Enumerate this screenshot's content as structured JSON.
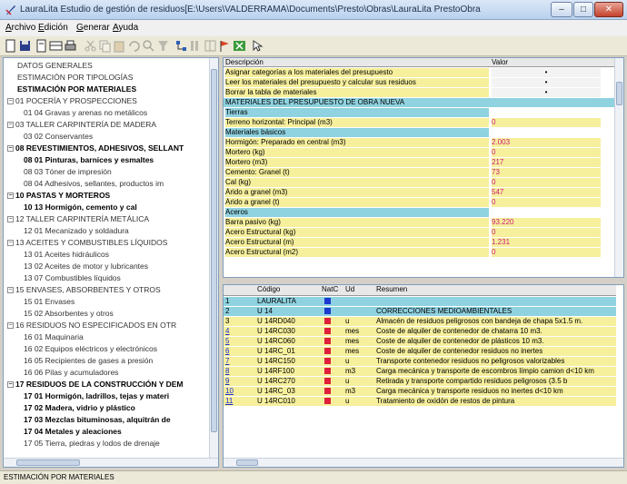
{
  "window": {
    "title": "LauraLita Estudio de gestión de residuos[E:\\Users\\VALDERRAMA\\Documents\\Presto\\Obras\\LauraLita PrestoObra"
  },
  "menu": {
    "items": [
      "Archivo",
      "Edición",
      "Generar",
      "Ayuda"
    ]
  },
  "tree": {
    "items": [
      {
        "label": "DATOS GENERALES",
        "bold": false,
        "toggle": "",
        "level": 0
      },
      {
        "label": "ESTIMACIÓN POR TIPOLOGÍAS",
        "bold": false,
        "toggle": "",
        "level": 0
      },
      {
        "label": "ESTIMACIÓN POR MATERIALES",
        "bold": true,
        "toggle": "",
        "level": 0
      },
      {
        "label": "01 POCERÍA Y PROSPECCIONES",
        "bold": false,
        "toggle": "−",
        "level": 0
      },
      {
        "label": "01 04 Gravas y arenas no metálicos",
        "bold": false,
        "toggle": "",
        "level": 1
      },
      {
        "label": "03 TALLER CARPINTERÍA DE MADERA",
        "bold": false,
        "toggle": "−",
        "level": 0
      },
      {
        "label": "03 02 Conservantes",
        "bold": false,
        "toggle": "",
        "level": 1
      },
      {
        "label": "08 REVESTIMIENTOS, ADHESIVOS, SELLANT",
        "bold": true,
        "toggle": "−",
        "level": 0
      },
      {
        "label": "08 01 Pinturas, barnices y esmaltes",
        "bold": true,
        "toggle": "",
        "level": 1
      },
      {
        "label": "08 03 Tóner de impresión",
        "bold": false,
        "toggle": "",
        "level": 1
      },
      {
        "label": "08 04 Adhesivos, sellantes, productos im",
        "bold": false,
        "toggle": "",
        "level": 1
      },
      {
        "label": "10 PASTAS Y MORTEROS",
        "bold": true,
        "toggle": "−",
        "level": 0
      },
      {
        "label": "10 13 Hormigón, cemento y cal",
        "bold": true,
        "toggle": "",
        "level": 1
      },
      {
        "label": "12 TALLER CARPINTERÍA METÁLICA",
        "bold": false,
        "toggle": "−",
        "level": 0
      },
      {
        "label": "12 01 Mecanizado y soldadura",
        "bold": false,
        "toggle": "",
        "level": 1
      },
      {
        "label": "13 ACEITES Y COMBUSTIBLES LÍQUIDOS",
        "bold": false,
        "toggle": "−",
        "level": 0
      },
      {
        "label": "13 01 Aceites hidráulicos",
        "bold": false,
        "toggle": "",
        "level": 1
      },
      {
        "label": "13 02 Aceites de motor y lubricantes",
        "bold": false,
        "toggle": "",
        "level": 1
      },
      {
        "label": "13 07 Combustibles líquidos",
        "bold": false,
        "toggle": "",
        "level": 1
      },
      {
        "label": "15 ENVASES, ABSORBENTES Y OTROS",
        "bold": false,
        "toggle": "−",
        "level": 0
      },
      {
        "label": "15 01 Envases",
        "bold": false,
        "toggle": "",
        "level": 1
      },
      {
        "label": "15 02 Absorbentes y otros",
        "bold": false,
        "toggle": "",
        "level": 1
      },
      {
        "label": "16 RESIDUOS NO ESPECIFICADOS EN OTR",
        "bold": false,
        "toggle": "−",
        "level": 0
      },
      {
        "label": "16 01 Maquinaria",
        "bold": false,
        "toggle": "",
        "level": 1
      },
      {
        "label": "16 02 Equipos eléctricos y electrónicos",
        "bold": false,
        "toggle": "",
        "level": 1
      },
      {
        "label": "16 05 Recipientes de gases a presión",
        "bold": false,
        "toggle": "",
        "level": 1
      },
      {
        "label": "16 06 Pilas y acumuladores",
        "bold": false,
        "toggle": "",
        "level": 1
      },
      {
        "label": "17 RESIDUOS DE LA CONSTRUCCIÓN Y DEM",
        "bold": true,
        "toggle": "−",
        "level": 0
      },
      {
        "label": "17 01 Hormigón, ladrillos, tejas y materi",
        "bold": true,
        "toggle": "",
        "level": 1
      },
      {
        "label": "17 02 Madera, vidrio y plástico",
        "bold": true,
        "toggle": "",
        "level": 1
      },
      {
        "label": "17 03 Mezclas bituminosas, alquitrán de",
        "bold": true,
        "toggle": "",
        "level": 1
      },
      {
        "label": "17 04 Metales y aleaciones",
        "bold": true,
        "toggle": "",
        "level": 1
      },
      {
        "label": "17 05 Tierra, piedras y lodos de drenaje",
        "bold": false,
        "toggle": "",
        "level": 1
      }
    ]
  },
  "upper": {
    "header": {
      "desc": "Descripción",
      "valor": "Valor"
    },
    "rows": [
      {
        "kind": "act",
        "desc": "Asignar categorías a los materiales del presupuesto",
        "val": "•"
      },
      {
        "kind": "act",
        "desc": "Leer los materiales del presupuesto y calcular sus residuos",
        "val": "•"
      },
      {
        "kind": "act",
        "desc": "Borrar la tabla de materiales",
        "val": "•"
      },
      {
        "kind": "sec",
        "desc": "MATERIALES DEL PRESUPUESTO DE OBRA NUEVA",
        "val": ""
      },
      {
        "kind": "sub",
        "desc": "Tierras",
        "val": ""
      },
      {
        "kind": "val",
        "desc": "Terreno horizontal: Principal (m3)",
        "val": "0"
      },
      {
        "kind": "sub",
        "desc": "Materiales básicos",
        "val": ""
      },
      {
        "kind": "val",
        "desc": "Hormigón: Preparado en central (m3)",
        "val": "2.003"
      },
      {
        "kind": "val",
        "desc": "Mortero (kg)",
        "val": "0"
      },
      {
        "kind": "val",
        "desc": "Mortero (m3)",
        "val": "217"
      },
      {
        "kind": "val",
        "desc": "Cemento: Granel (t)",
        "val": "73"
      },
      {
        "kind": "val",
        "desc": "Cal (kg)",
        "val": "0"
      },
      {
        "kind": "val",
        "desc": "Árido a granel (m3)",
        "val": "547"
      },
      {
        "kind": "val",
        "desc": "Árido a granel (t)",
        "val": "0"
      },
      {
        "kind": "sub",
        "desc": "Aceros",
        "val": ""
      },
      {
        "kind": "val",
        "desc": "Barra pasivo (kg)",
        "val": "93.220"
      },
      {
        "kind": "val",
        "desc": "Acero Estructural (kg)",
        "val": "0"
      },
      {
        "kind": "val",
        "desc": "Acero Estructural (m)",
        "val": "1.231"
      },
      {
        "kind": "val",
        "desc": "Acero Estructural (m2)",
        "val": "0"
      }
    ]
  },
  "lower": {
    "header": {
      "codigo": "Código",
      "natc": "NatC",
      "ud": "Ud",
      "resumen": "Resumen"
    },
    "rows": [
      {
        "n": "1",
        "codigo": "LAURALITA",
        "nat": "blue",
        "ud": "",
        "resumen": "",
        "kind": "cy"
      },
      {
        "n": "2",
        "codigo": "U 14",
        "nat": "blue",
        "ud": "",
        "resumen": "CORRECCIONES MEDIOAMBIENTALES",
        "kind": "cy"
      },
      {
        "n": "3",
        "codigo": "U 14RD040",
        "nat": "red",
        "ud": "u",
        "resumen": "Almacén de residuos peligrosos con bandeja de chapa 5x1.5 m.",
        "kind": "data"
      },
      {
        "n": "4",
        "codigo": "U 14RC030",
        "nat": "red",
        "ud": "mes",
        "resumen": "Coste de alquiler de contenedor de chatarra 10 m3.",
        "kind": "data"
      },
      {
        "n": "5",
        "codigo": "U 14RC060",
        "nat": "red",
        "ud": "mes",
        "resumen": "Coste de alquiler de contenedor de plásticos 10 m3.",
        "kind": "data"
      },
      {
        "n": "6",
        "codigo": "U 14RC_01",
        "nat": "red",
        "ud": "mes",
        "resumen": "Coste de alquiler de contenedor residuos no inertes",
        "kind": "data"
      },
      {
        "n": "7",
        "codigo": "U 14RC150",
        "nat": "red",
        "ud": "u",
        "resumen": "Transporte contenedor residuos no peligrosos valorizables",
        "kind": "data"
      },
      {
        "n": "8",
        "codigo": "U 14RF100",
        "nat": "red",
        "ud": "m3",
        "resumen": "Carga mecánica y transporte de escombros límpio camion d<10 km",
        "kind": "data"
      },
      {
        "n": "9",
        "codigo": "U 14RC270",
        "nat": "red",
        "ud": "u",
        "resumen": "Retirada y transporte compartido residuos peligrosos (3.5 b",
        "kind": "data"
      },
      {
        "n": "10",
        "codigo": "U 14RC_03",
        "nat": "red",
        "ud": "m3",
        "resumen": "Carga mecánica y transporte residuos no inertes d<10 km",
        "kind": "data"
      },
      {
        "n": "11",
        "codigo": "U 14RC010",
        "nat": "red",
        "ud": "u",
        "resumen": "Tratamiento de oxidón de restos de pintura",
        "kind": "data"
      }
    ]
  },
  "status": {
    "text": "ESTIMACIÓN POR MATERIALES"
  },
  "colors": {
    "yellow": "#f6ef9c",
    "cyan": "#8fd2e0",
    "magenta": "#d01a7a",
    "natRed": "#e0203a",
    "natBlue": "#1a3ad0"
  }
}
